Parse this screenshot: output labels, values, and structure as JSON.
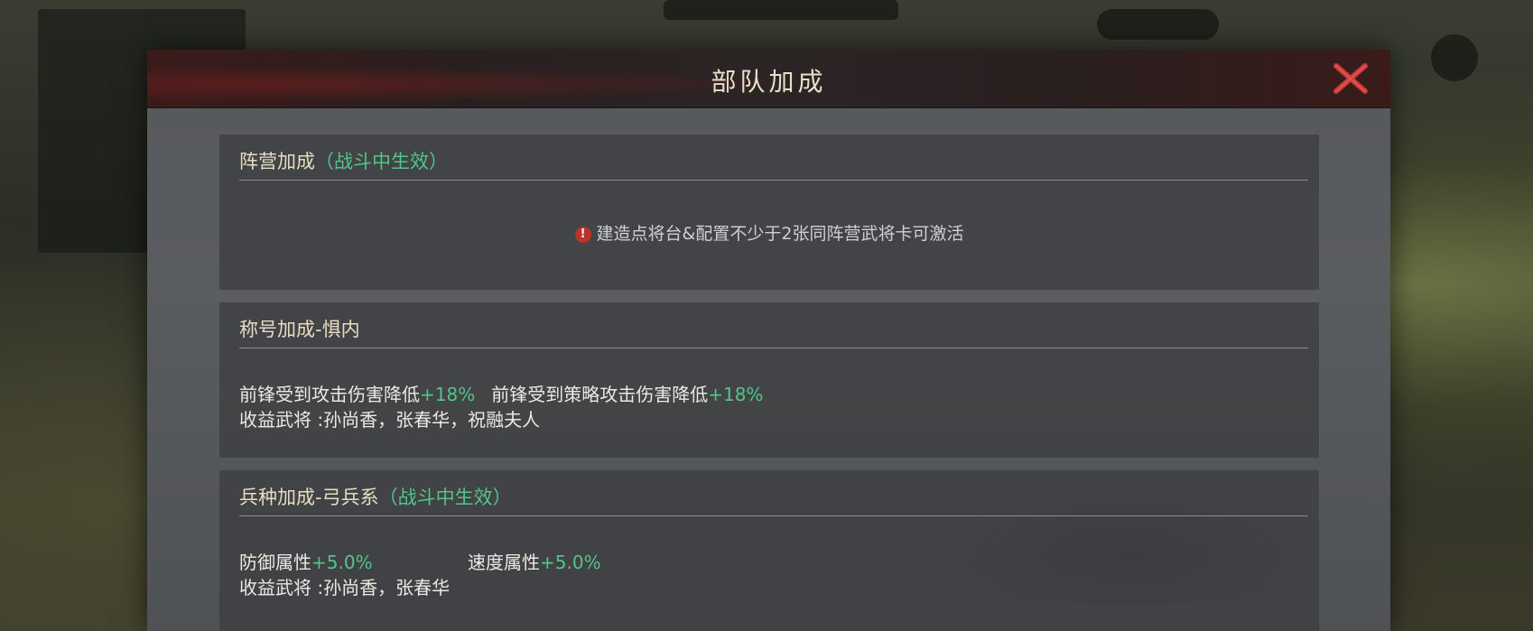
{
  "dialog": {
    "title": "部队加成",
    "close_icon": "close-x-icon",
    "accent_color": "#52c48a"
  },
  "sections": {
    "faction": {
      "title": "阵营加成",
      "note": "（战斗中生效）",
      "notice_icon": "exclamation-icon",
      "notice": "建造点将台&配置不少于2张同阵营武将卡可激活"
    },
    "title_bonus": {
      "title": "称号加成-惧内",
      "effect1_label": "前锋受到攻击伤害降低",
      "effect1_value": "+18%",
      "effect2_label": "前锋受到策略攻击伤害降低",
      "effect2_value": "+18%",
      "beneficiaries": "收益武将 :孙尚香，张春华，祝融夫人"
    },
    "troop_bonus": {
      "title": "兵种加成-弓兵系",
      "note": "（战斗中生效）",
      "effect1_label": "防御属性",
      "effect1_value": "+5.0%",
      "effect2_label": "速度属性",
      "effect2_value": "+5.0%",
      "beneficiaries": "收益武将 :孙尚香，张春华"
    }
  }
}
